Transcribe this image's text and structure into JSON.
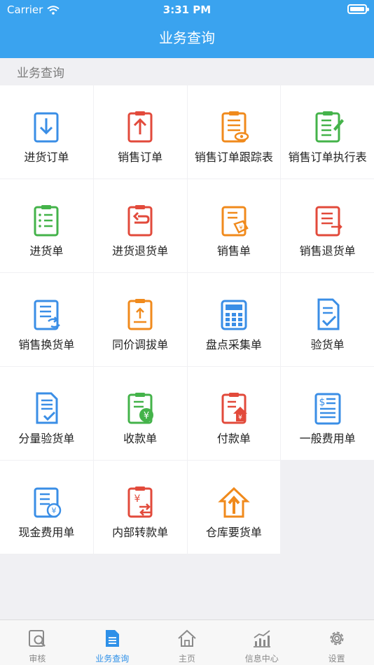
{
  "status": {
    "carrier": "Carrier",
    "time": "3:31 PM"
  },
  "nav": {
    "title": "业务查询"
  },
  "section": {
    "title": "业务查询"
  },
  "tiles": [
    {
      "label": "进货订单",
      "icon": "purchase-order-icon",
      "color": "#3a8ee6"
    },
    {
      "label": "销售订单",
      "icon": "sales-order-icon",
      "color": "#e24a3b"
    },
    {
      "label": "销售订单跟踪表",
      "icon": "sales-order-tracking-icon",
      "color": "#f08a1c"
    },
    {
      "label": "销售订单执行表",
      "icon": "sales-order-execution-icon",
      "color": "#44b34a"
    },
    {
      "label": "进货单",
      "icon": "purchase-receipt-icon",
      "color": "#44b34a"
    },
    {
      "label": "进货退货单",
      "icon": "purchase-return-icon",
      "color": "#e24a3b"
    },
    {
      "label": "销售单",
      "icon": "sales-receipt-icon",
      "color": "#f08a1c"
    },
    {
      "label": "销售退货单",
      "icon": "sales-return-icon",
      "color": "#e24a3b"
    },
    {
      "label": "销售换货单",
      "icon": "sales-exchange-icon",
      "color": "#3a8ee6"
    },
    {
      "label": "同价调拔单",
      "icon": "transfer-icon",
      "color": "#f08a1c"
    },
    {
      "label": "盘点采集单",
      "icon": "inventory-count-icon",
      "color": "#3a8ee6"
    },
    {
      "label": "验货单",
      "icon": "inspection-icon",
      "color": "#3a8ee6"
    },
    {
      "label": "分量验货单",
      "icon": "partial-inspection-icon",
      "color": "#3a8ee6"
    },
    {
      "label": "收款单",
      "icon": "receipt-payment-icon",
      "color": "#44b34a"
    },
    {
      "label": "付款单",
      "icon": "payment-icon",
      "color": "#e24a3b"
    },
    {
      "label": "一般费用单",
      "icon": "general-expense-icon",
      "color": "#3a8ee6"
    },
    {
      "label": "现金费用单",
      "icon": "cash-expense-icon",
      "color": "#3a8ee6"
    },
    {
      "label": "内部转款单",
      "icon": "internal-transfer-icon",
      "color": "#e24a3b"
    },
    {
      "label": "仓库要货单",
      "icon": "warehouse-request-icon",
      "color": "#f08a1c"
    }
  ],
  "tabs": [
    {
      "label": "审核",
      "icon": "audit-icon",
      "active": false
    },
    {
      "label": "业务查询",
      "icon": "document-icon",
      "active": true
    },
    {
      "label": "主页",
      "icon": "home-icon",
      "active": false
    },
    {
      "label": "信息中心",
      "icon": "chart-icon",
      "active": false
    },
    {
      "label": "设置",
      "icon": "gear-icon",
      "active": false
    }
  ],
  "colors": {
    "primary": "#3aa3ef",
    "tab_active": "#2e90e8",
    "tab_inactive": "#8a8a8a"
  }
}
